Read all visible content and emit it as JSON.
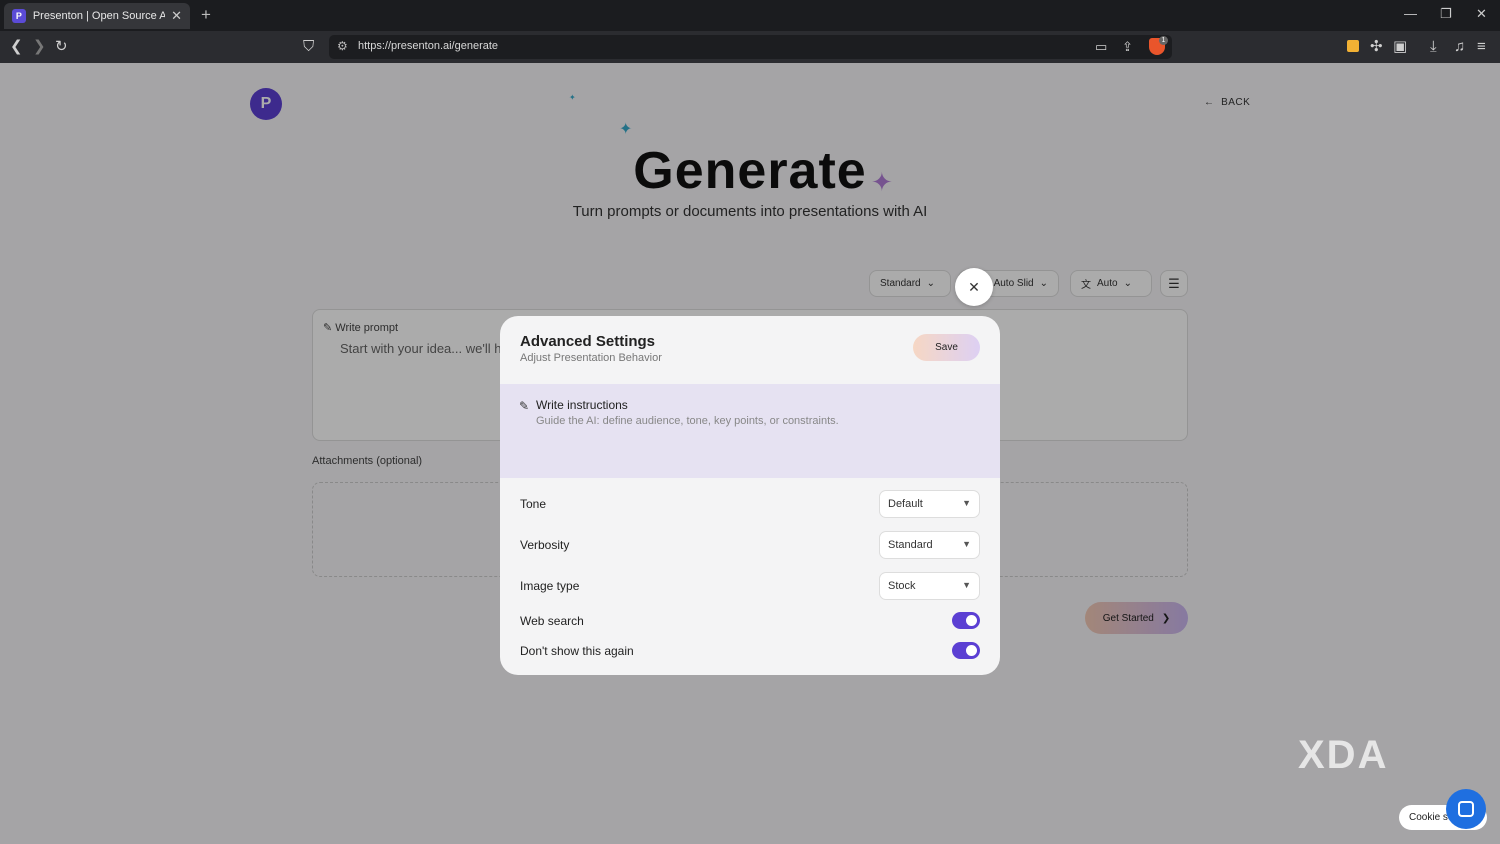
{
  "browser": {
    "tab_title": "Presenton | Open Source AI pres",
    "new_tab": "+",
    "url": "https://presenton.ai/generate",
    "ext_badge": "1"
  },
  "page": {
    "back_label": "BACK",
    "logo_glyph": "P",
    "title": "Generate",
    "subtitle": "Turn prompts or documents into presentations with AI",
    "pills": {
      "standard": "Standard",
      "slides": "Auto Slid",
      "language": "Auto"
    },
    "prompt_label": "Write prompt",
    "prompt_placeholder": "Start with your idea... we'll h",
    "attachments_label": "Attachments (optional)",
    "get_started": "Get Started",
    "cookie": "Cookie se",
    "watermark": "XDA"
  },
  "modal": {
    "title": "Advanced Settings",
    "subtitle": "Adjust Presentation Behavior",
    "save": "Save",
    "instructions_title": "Write instructions",
    "instructions_hint": "Guide the AI: define audience, tone, key points, or constraints.",
    "tone_label": "Tone",
    "tone_value": "Default",
    "verbosity_label": "Verbosity",
    "verbosity_value": "Standard",
    "image_type_label": "Image type",
    "image_type_value": "Stock",
    "web_search_label": "Web search",
    "web_search_on": true,
    "dont_show_label": "Don't show this again",
    "dont_show_on": true
  },
  "colors": {
    "brand": "#5b3fd3",
    "instructions_bg": "#e6e2f2"
  }
}
